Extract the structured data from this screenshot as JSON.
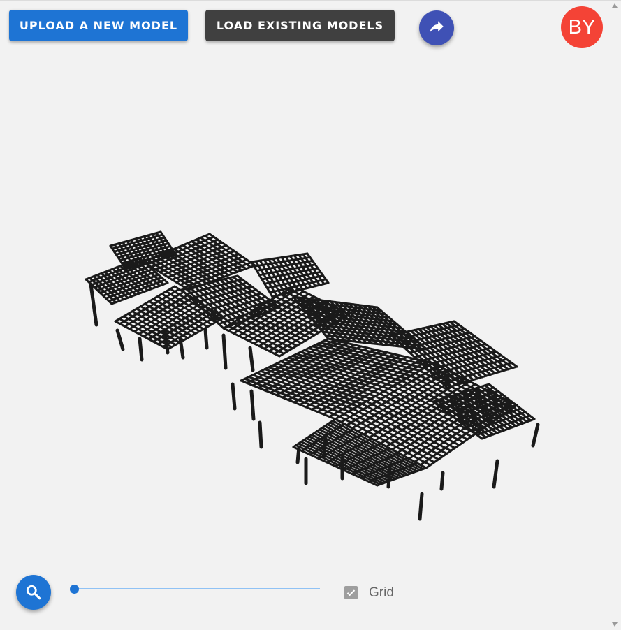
{
  "toolbar": {
    "upload_label": "UPLOAD A NEW MODEL",
    "load_label": "LOAD EXISTING MODELS",
    "share_icon": "share-icon"
  },
  "user": {
    "initials": "BY",
    "avatar_color": "#f44336"
  },
  "controls": {
    "search_icon": "search-icon",
    "slider_value": 0,
    "grid_label": "Grid",
    "grid_checked": true
  },
  "colors": {
    "primary": "#1e74d4",
    "secondary_button": "#404040",
    "share_fab": "#3f51b5",
    "background": "#f2f2f2",
    "model_stroke": "#1a1a1a"
  }
}
